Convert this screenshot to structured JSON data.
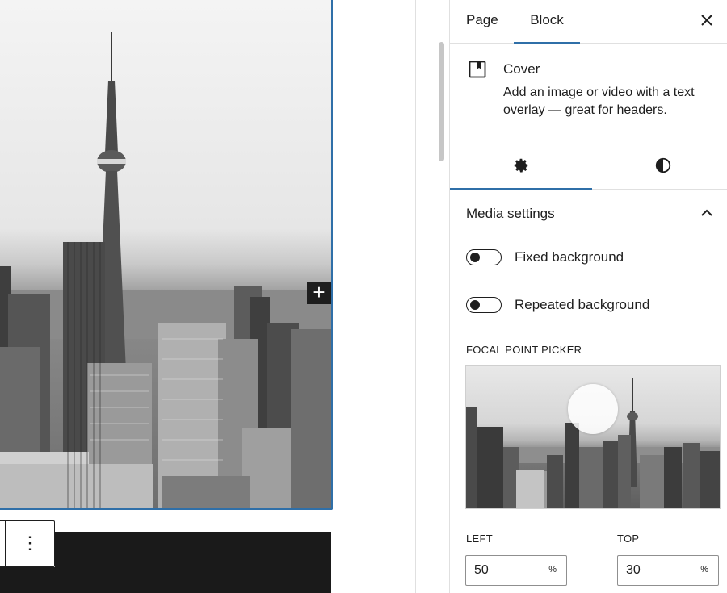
{
  "sidebar": {
    "tabs": {
      "page": "Page",
      "block": "Block"
    },
    "block_card": {
      "title": "Cover",
      "description": "Add an image or video with a text overlay — great for headers."
    },
    "media_settings": {
      "title": "Media settings",
      "fixed_background": {
        "label": "Fixed background",
        "checked": false
      },
      "repeated_background": {
        "label": "Repeated background",
        "checked": false
      }
    },
    "focal_point": {
      "label": "FOCAL POINT PICKER",
      "left_label": "LEFT",
      "top_label": "TOP",
      "left_value": "50",
      "top_value": "30",
      "unit": "%"
    }
  },
  "canvas": {
    "inserter_symbol": "+",
    "more_options_symbol": "⋮"
  },
  "colors": {
    "accent": "#2f6fa8",
    "text": "#1e1e1e",
    "border": "#e0e0e0"
  }
}
